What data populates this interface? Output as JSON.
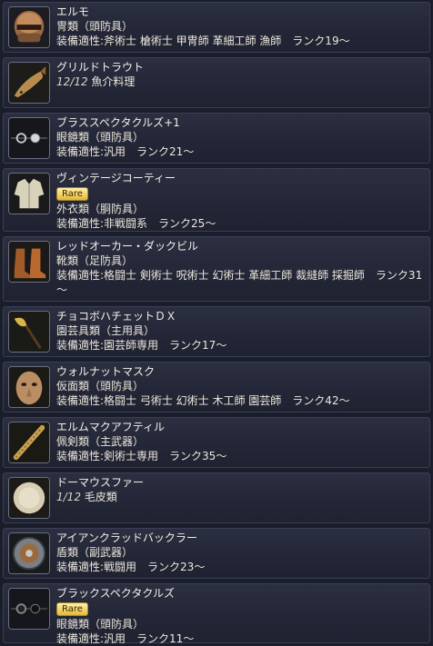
{
  "items": [
    {
      "name": "エルモ",
      "icon": "helmet-icon",
      "lines": [
        "冑類（頭防具）",
        "装備適性:斧術士 槍術士 甲冑師 革細工師 漁師　ランク19～"
      ]
    },
    {
      "name": "グリルドトラウト",
      "icon": "fish-icon",
      "qty": "12/12",
      "qty_label": "魚介料理",
      "lines": []
    },
    {
      "name": "ブラススペクタクルズ+1",
      "icon": "spectacles-icon",
      "lines": [
        "眼鏡類（頭防具）",
        "装備適性:汎用　ランク21～"
      ]
    },
    {
      "name": "ヴィンテージコーティー",
      "icon": "coat-icon",
      "rare": "Rare",
      "lines": [
        "外衣類（胴防具）",
        "装備適性:非戦闘系　ランク25～"
      ]
    },
    {
      "name": "レッドオーカー・ダックビル",
      "icon": "boots-icon",
      "lines": [
        "靴類（足防具）",
        "装備適性:格闘士 剣術士 呪術士 幻術士 革細工師 裁縫師 採掘師　ランク31～"
      ]
    },
    {
      "name": "チョコボハチェットＤＸ",
      "icon": "hatchet-icon",
      "lines": [
        "園芸具類（主用具）",
        "装備適性:園芸師専用　ランク17～"
      ]
    },
    {
      "name": "ウォルナットマスク",
      "icon": "mask-icon",
      "lines": [
        "仮面類（頭防具）",
        "装備適性:格闘士 弓術士 幻術士 木工師 園芸師　ランク42～"
      ]
    },
    {
      "name": "エルムマクアフティル",
      "icon": "club-icon",
      "lines": [
        "佩剣類（主武器）",
        "装備適性:剣術士専用　ランク35～"
      ]
    },
    {
      "name": "ドーマウスファー",
      "icon": "fur-icon",
      "qty": "1/12",
      "qty_label": "毛皮類",
      "lines": []
    },
    {
      "name": "アイアンクラッドバックラー",
      "icon": "buckler-icon",
      "lines": [
        "盾類（副武器）",
        "装備適性:戦闘用　ランク23～"
      ]
    },
    {
      "name": "ブラックスペクタクルズ",
      "icon": "spectacles-icon",
      "rare": "Rare",
      "lines": [
        "眼鏡類（頭防具）",
        "装備適性:汎用　ランク11～"
      ]
    }
  ]
}
